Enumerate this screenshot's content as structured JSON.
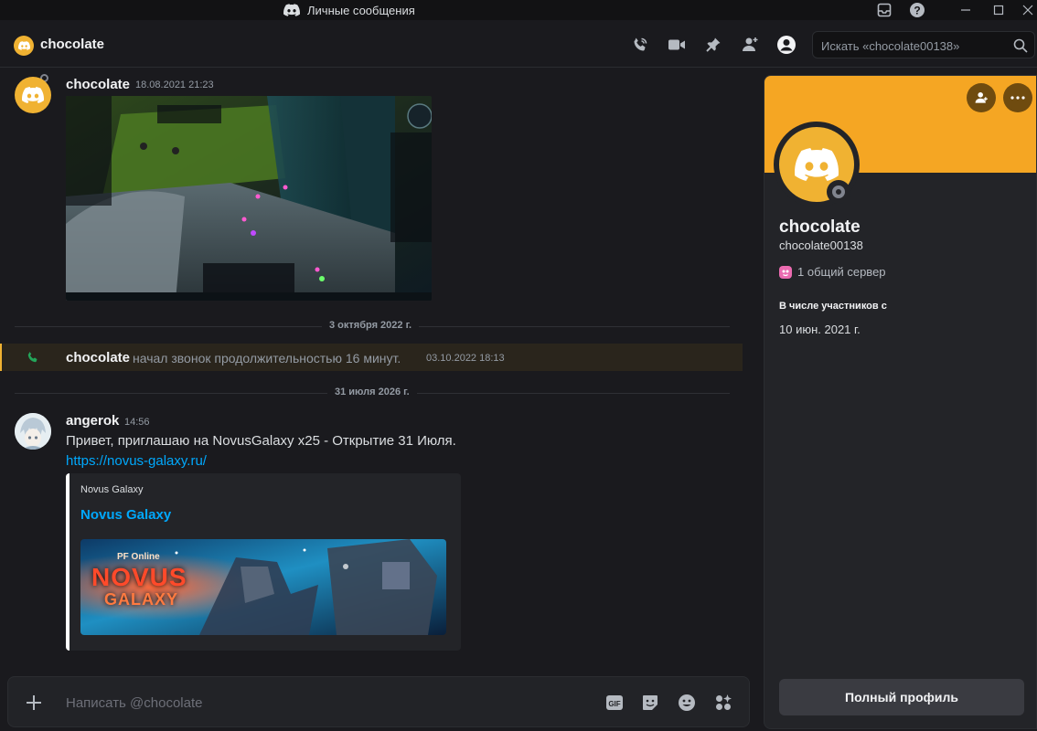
{
  "window": {
    "title": "Личные сообщения"
  },
  "header": {
    "title": "chocolate",
    "search_placeholder": "Искать «chocolate00138»"
  },
  "messages": [
    {
      "username": "chocolate",
      "timestamp": "18.08.2021 21:23",
      "attachment": "game-screenshot"
    },
    {
      "divider": "3 октября 2022 г."
    },
    {
      "call_user": "chocolate",
      "call_text": "начал звонок продолжительностью 16 минут.",
      "call_timestamp": "03.10.2022 18:13"
    },
    {
      "divider": "31 июля 2026 г."
    },
    {
      "username": "angerok",
      "timestamp": "14:56",
      "text": "Привет, приглашаю на NovusGalaxy x25 - Открытие 31 Июля.",
      "link": "https://novus-galaxy.ru/",
      "embed": {
        "provider": "Novus Galaxy",
        "title": "Novus Galaxy",
        "image_logo_line1": "Novus",
        "image_logo_line2": "Galaxy",
        "image_logo_small": "PF Online"
      }
    }
  ],
  "composer": {
    "placeholder": "Написать @chocolate"
  },
  "profile": {
    "display_name": "chocolate",
    "username": "chocolate00138",
    "mutual_servers": "1 общий сервер",
    "member_since_label": "В числе участников с",
    "member_since": "10 июн. 2021 г.",
    "full_profile_button": "Полный профиль"
  },
  "colors": {
    "accent": "#f0b232",
    "banner": "#f5a623",
    "link": "#00a8fc",
    "background": "#1a1a1e"
  }
}
